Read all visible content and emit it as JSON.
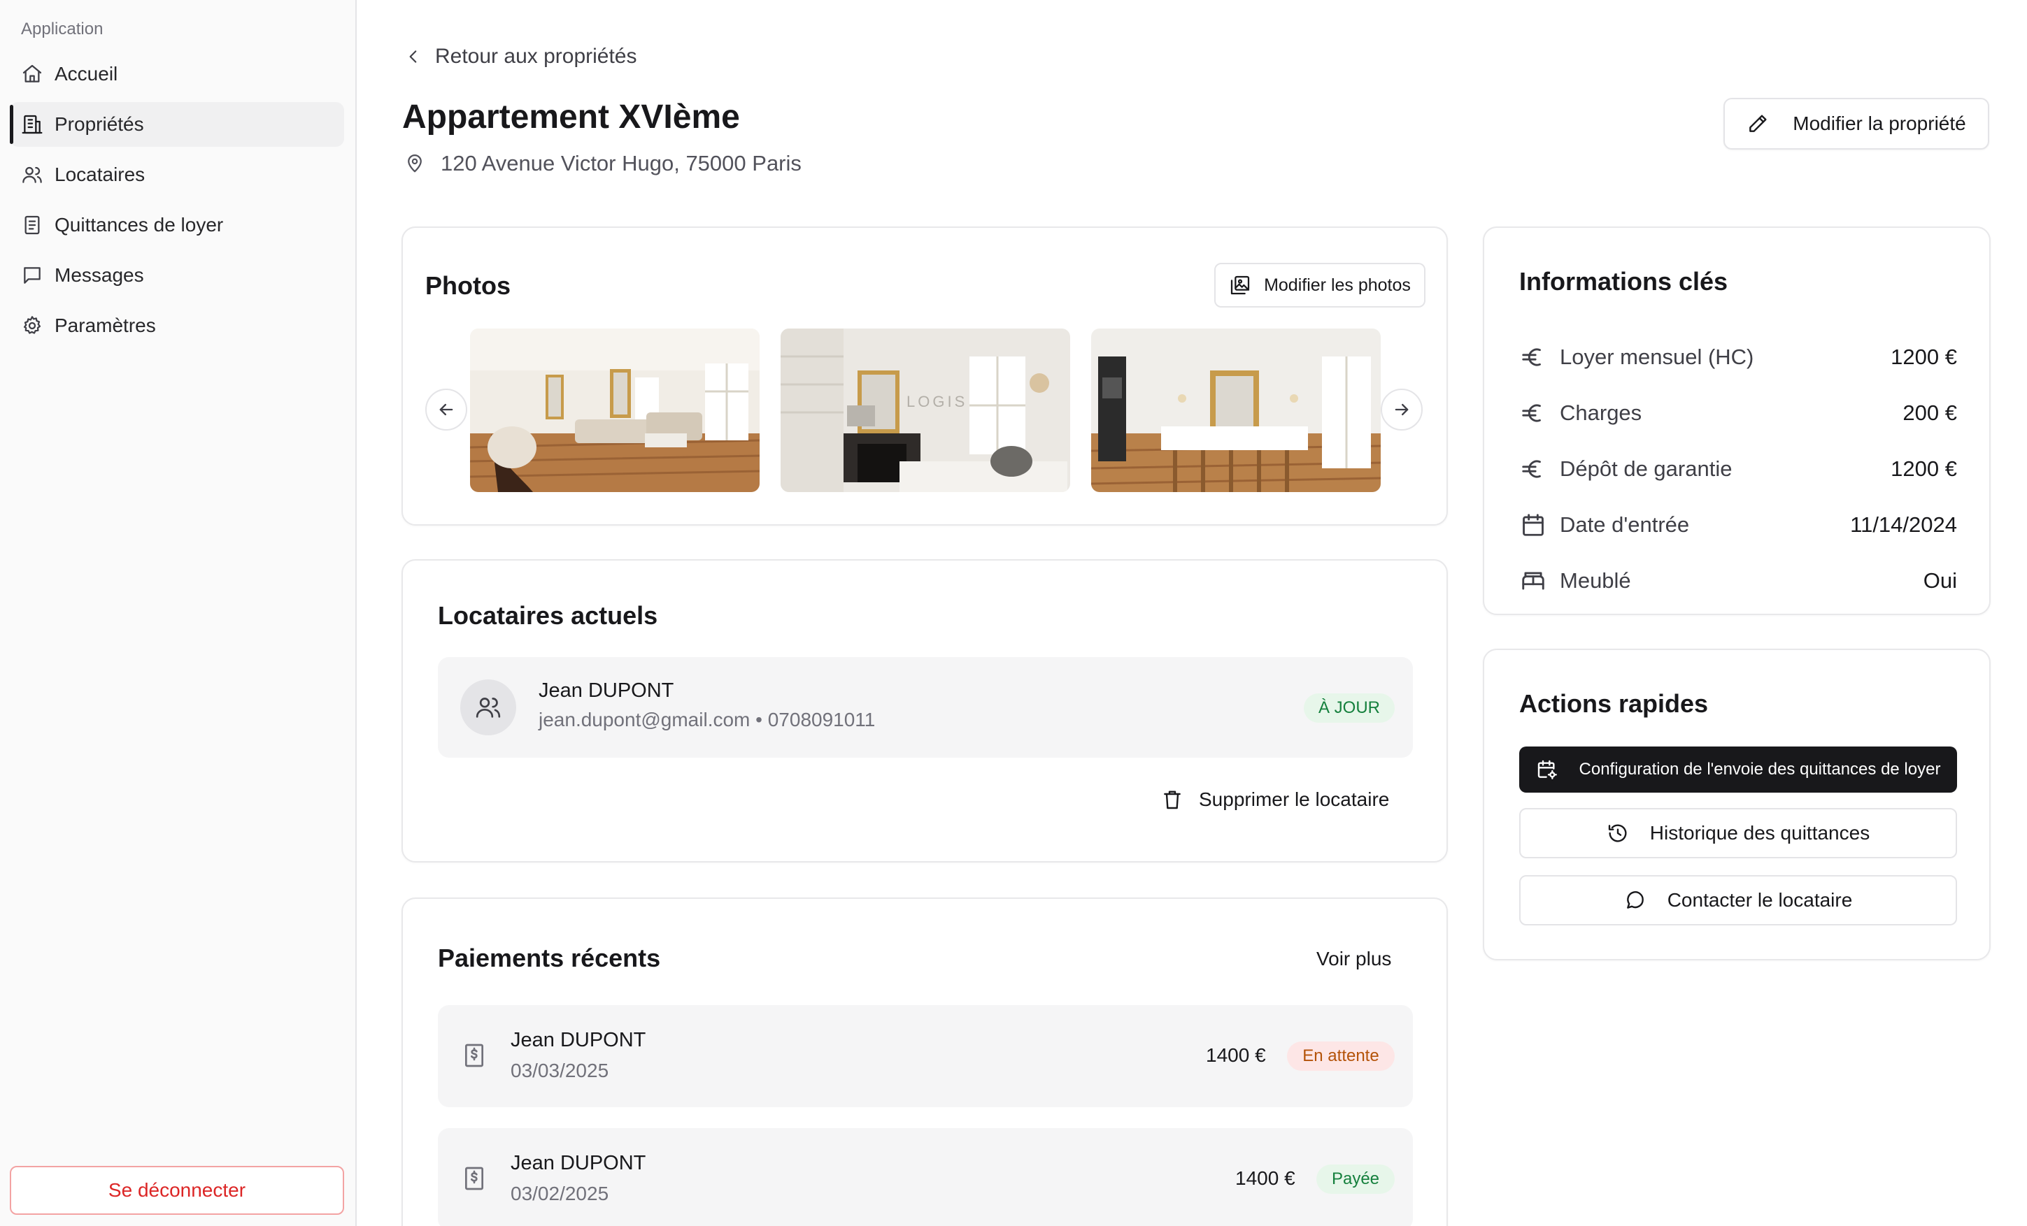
{
  "sidebar": {
    "group_label": "Application",
    "items": [
      {
        "label": "Accueil",
        "icon": "home-icon"
      },
      {
        "label": "Propriétés",
        "icon": "building-icon",
        "active": true
      },
      {
        "label": "Locataires",
        "icon": "users-icon"
      },
      {
        "label": "Quittances de loyer",
        "icon": "receipt-icon"
      },
      {
        "label": "Messages",
        "icon": "message-icon"
      },
      {
        "label": "Paramètres",
        "icon": "gear-icon"
      }
    ],
    "logout_label": "Se déconnecter"
  },
  "header": {
    "back_label": "Retour aux propriétés",
    "title": "Appartement XVIème",
    "address": "120 Avenue Victor Hugo, 75000 Paris",
    "edit_label": "Modifier la propriété"
  },
  "photos": {
    "title": "Photos",
    "edit_label": "Modifier les photos",
    "watermark": "LOGIS"
  },
  "tenants": {
    "title": "Locataires actuels",
    "items": [
      {
        "name": "Jean DUPONT",
        "contact": "jean.dupont@gmail.com • 0708091011",
        "status": "À JOUR"
      }
    ],
    "delete_label": "Supprimer le locataire"
  },
  "payments": {
    "title": "Paiements récents",
    "see_more_label": "Voir plus",
    "items": [
      {
        "name": "Jean DUPONT",
        "date": "03/03/2025",
        "amount": "1400 €",
        "status": "En attente"
      },
      {
        "name": "Jean DUPONT",
        "date": "03/02/2025",
        "amount": "1400 €",
        "status": "Payée"
      }
    ]
  },
  "key_info": {
    "title": "Informations clés",
    "rows": [
      {
        "label": "Loyer mensuel (HC)",
        "value": "1200 €",
        "icon": "euro-icon"
      },
      {
        "label": "Charges",
        "value": "200 €",
        "icon": "euro-icon"
      },
      {
        "label": "Dépôt de garantie",
        "value": "1200 €",
        "icon": "euro-icon"
      },
      {
        "label": "Date d'entrée",
        "value": "11/14/2024",
        "icon": "calendar-icon"
      },
      {
        "label": "Meublé",
        "value": "Oui",
        "icon": "bed-icon"
      }
    ]
  },
  "quick_actions": {
    "title": "Actions rapides",
    "items": [
      {
        "label": "Configuration de l'envoie des quittances de loyer",
        "icon": "calendar-settings-icon"
      },
      {
        "label": "Historique des quittances",
        "icon": "history-icon"
      },
      {
        "label": "Contacter le locataire",
        "icon": "chat-bubble-icon"
      }
    ]
  },
  "colors": {
    "accent_dark": "#18181b",
    "danger": "#dc2626",
    "success_bg": "#e7f6ea",
    "success_text": "#15803d",
    "pending_bg": "#fde6e6",
    "pending_text": "#b45309"
  }
}
